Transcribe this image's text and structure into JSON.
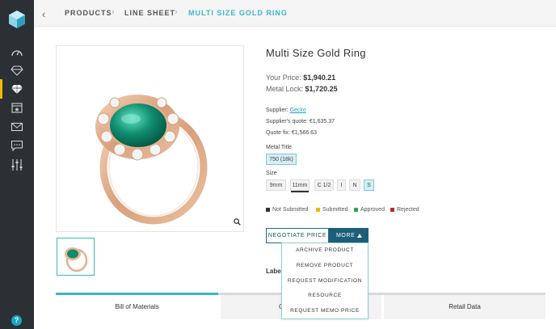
{
  "breadcrumb": [
    "PRODUCTS",
    "LINE SHEET",
    "MULTI SIZE GOLD RING"
  ],
  "product": {
    "title": "Multi Size Gold Ring",
    "your_price_label": "Your Price:",
    "your_price": "$1,940.21",
    "metal_lock_label": "Metal Lock:",
    "metal_lock": "$1,720.25",
    "supplier_label": "Supplier:",
    "supplier": "Gecko",
    "supplier_quote": "Supplier's quote: €1,635.37",
    "quote_fix": "Quote fix: €1,566.63"
  },
  "metal_title": {
    "label": "Metal Title",
    "options": [
      "750 (18k)"
    ],
    "selected": "750 (18k)"
  },
  "size": {
    "label": "Size",
    "options": [
      "9mm",
      "11mm",
      "C 1/2",
      "I",
      "N",
      "S"
    ],
    "selected": "S",
    "underlined": "11mm"
  },
  "legend": [
    {
      "label": "Not Submitted",
      "color": "#333333"
    },
    {
      "label": "Submitted",
      "color": "#f0b800"
    },
    {
      "label": "Approved",
      "color": "#2ea84f"
    },
    {
      "label": "Rejected",
      "color": "#c0282d"
    }
  ],
  "actions": {
    "negotiate": "NEGOTIATE PRICE",
    "more": "MORE"
  },
  "dropdown": [
    "ARCHIVE PRODUCT",
    "REMOVE PRODUCT",
    "REQUEST MODIFICATION",
    "RESOURCE",
    "REQUEST MEMO PRICE"
  ],
  "label_peek": "Labe",
  "tabs": [
    "Bill of Materials",
    "C",
    "Retail Data"
  ],
  "active_tab": "Bill of Materials",
  "help": "?",
  "colors": {
    "accent": "#3bb6cc",
    "sidebar": "#2b3035",
    "active_marker": "#f0b800",
    "button_dark": "#1d5f79"
  },
  "sidebar_icons": [
    "dashboard-icon",
    "diamond-outline-icon",
    "diamond-icon",
    "calendar-star-icon",
    "mail-icon",
    "chat-icon",
    "sliders-icon"
  ]
}
